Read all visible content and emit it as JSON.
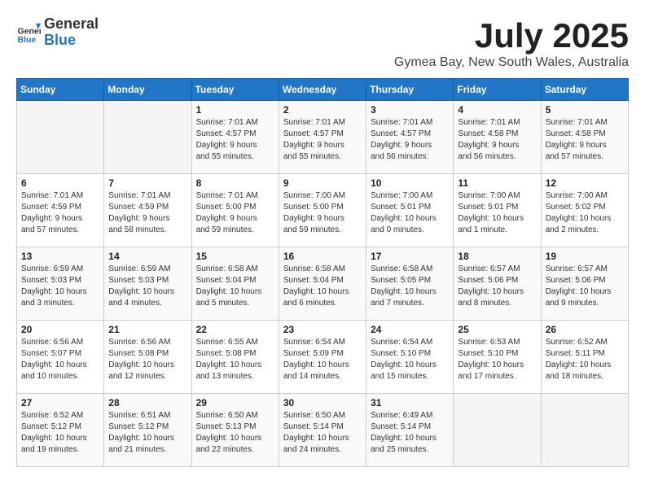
{
  "header": {
    "logo": {
      "line1": "General",
      "line2": "Blue"
    },
    "title": "July 2025",
    "location": "Gymea Bay, New South Wales, Australia"
  },
  "weekdays": [
    "Sunday",
    "Monday",
    "Tuesday",
    "Wednesday",
    "Thursday",
    "Friday",
    "Saturday"
  ],
  "weeks": [
    [
      {
        "day": "",
        "info": ""
      },
      {
        "day": "",
        "info": ""
      },
      {
        "day": "1",
        "info": "Sunrise: 7:01 AM\nSunset: 4:57 PM\nDaylight: 9 hours\nand 55 minutes."
      },
      {
        "day": "2",
        "info": "Sunrise: 7:01 AM\nSunset: 4:57 PM\nDaylight: 9 hours\nand 55 minutes."
      },
      {
        "day": "3",
        "info": "Sunrise: 7:01 AM\nSunset: 4:57 PM\nDaylight: 9 hours\nand 56 minutes."
      },
      {
        "day": "4",
        "info": "Sunrise: 7:01 AM\nSunset: 4:58 PM\nDaylight: 9 hours\nand 56 minutes."
      },
      {
        "day": "5",
        "info": "Sunrise: 7:01 AM\nSunset: 4:58 PM\nDaylight: 9 hours\nand 57 minutes."
      }
    ],
    [
      {
        "day": "6",
        "info": "Sunrise: 7:01 AM\nSunset: 4:59 PM\nDaylight: 9 hours\nand 57 minutes."
      },
      {
        "day": "7",
        "info": "Sunrise: 7:01 AM\nSunset: 4:59 PM\nDaylight: 9 hours\nand 58 minutes."
      },
      {
        "day": "8",
        "info": "Sunrise: 7:01 AM\nSunset: 5:00 PM\nDaylight: 9 hours\nand 59 minutes."
      },
      {
        "day": "9",
        "info": "Sunrise: 7:00 AM\nSunset: 5:00 PM\nDaylight: 9 hours\nand 59 minutes."
      },
      {
        "day": "10",
        "info": "Sunrise: 7:00 AM\nSunset: 5:01 PM\nDaylight: 10 hours\nand 0 minutes."
      },
      {
        "day": "11",
        "info": "Sunrise: 7:00 AM\nSunset: 5:01 PM\nDaylight: 10 hours\nand 1 minute."
      },
      {
        "day": "12",
        "info": "Sunrise: 7:00 AM\nSunset: 5:02 PM\nDaylight: 10 hours\nand 2 minutes."
      }
    ],
    [
      {
        "day": "13",
        "info": "Sunrise: 6:59 AM\nSunset: 5:03 PM\nDaylight: 10 hours\nand 3 minutes."
      },
      {
        "day": "14",
        "info": "Sunrise: 6:59 AM\nSunset: 5:03 PM\nDaylight: 10 hours\nand 4 minutes."
      },
      {
        "day": "15",
        "info": "Sunrise: 6:58 AM\nSunset: 5:04 PM\nDaylight: 10 hours\nand 5 minutes."
      },
      {
        "day": "16",
        "info": "Sunrise: 6:58 AM\nSunset: 5:04 PM\nDaylight: 10 hours\nand 6 minutes."
      },
      {
        "day": "17",
        "info": "Sunrise: 6:58 AM\nSunset: 5:05 PM\nDaylight: 10 hours\nand 7 minutes."
      },
      {
        "day": "18",
        "info": "Sunrise: 6:57 AM\nSunset: 5:06 PM\nDaylight: 10 hours\nand 8 minutes."
      },
      {
        "day": "19",
        "info": "Sunrise: 6:57 AM\nSunset: 5:06 PM\nDaylight: 10 hours\nand 9 minutes."
      }
    ],
    [
      {
        "day": "20",
        "info": "Sunrise: 6:56 AM\nSunset: 5:07 PM\nDaylight: 10 hours\nand 10 minutes."
      },
      {
        "day": "21",
        "info": "Sunrise: 6:56 AM\nSunset: 5:08 PM\nDaylight: 10 hours\nand 12 minutes."
      },
      {
        "day": "22",
        "info": "Sunrise: 6:55 AM\nSunset: 5:08 PM\nDaylight: 10 hours\nand 13 minutes."
      },
      {
        "day": "23",
        "info": "Sunrise: 6:54 AM\nSunset: 5:09 PM\nDaylight: 10 hours\nand 14 minutes."
      },
      {
        "day": "24",
        "info": "Sunrise: 6:54 AM\nSunset: 5:10 PM\nDaylight: 10 hours\nand 15 minutes."
      },
      {
        "day": "25",
        "info": "Sunrise: 6:53 AM\nSunset: 5:10 PM\nDaylight: 10 hours\nand 17 minutes."
      },
      {
        "day": "26",
        "info": "Sunrise: 6:52 AM\nSunset: 5:11 PM\nDaylight: 10 hours\nand 18 minutes."
      }
    ],
    [
      {
        "day": "27",
        "info": "Sunrise: 6:52 AM\nSunset: 5:12 PM\nDaylight: 10 hours\nand 19 minutes."
      },
      {
        "day": "28",
        "info": "Sunrise: 6:51 AM\nSunset: 5:12 PM\nDaylight: 10 hours\nand 21 minutes."
      },
      {
        "day": "29",
        "info": "Sunrise: 6:50 AM\nSunset: 5:13 PM\nDaylight: 10 hours\nand 22 minutes."
      },
      {
        "day": "30",
        "info": "Sunrise: 6:50 AM\nSunset: 5:14 PM\nDaylight: 10 hours\nand 24 minutes."
      },
      {
        "day": "31",
        "info": "Sunrise: 6:49 AM\nSunset: 5:14 PM\nDaylight: 10 hours\nand 25 minutes."
      },
      {
        "day": "",
        "info": ""
      },
      {
        "day": "",
        "info": ""
      }
    ]
  ]
}
